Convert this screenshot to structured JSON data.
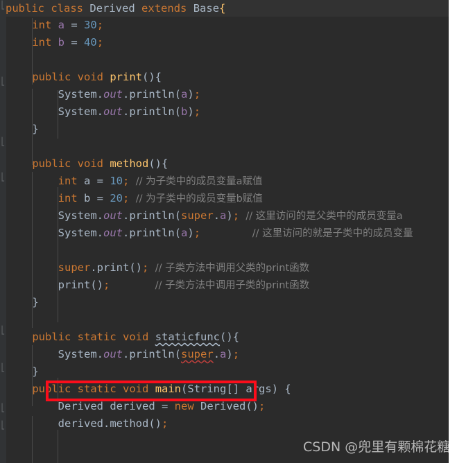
{
  "editor": {
    "theme": "darcula",
    "background": "#2b2b2b",
    "gutter_background": "#313335",
    "current_line_background": "#323232",
    "accent_red": "#fc0d1b",
    "font_size_px": 15.5,
    "line_height_px": 25
  },
  "gutter": {
    "fold_markers": [
      "⎣",
      "⎣",
      "⎣",
      "⎣",
      "⎣",
      "⎣",
      "⎣",
      "⎣"
    ]
  },
  "code_lines": [
    {
      "indent": 0,
      "tokens": [
        {
          "t": "public",
          "c": "kw"
        },
        {
          "t": " ",
          "c": "pln"
        },
        {
          "t": "class",
          "c": "kw"
        },
        {
          "t": " ",
          "c": "pln"
        },
        {
          "t": "Derived",
          "c": "cls"
        },
        {
          "t": " ",
          "c": "pln"
        },
        {
          "t": "extends",
          "c": "kw"
        },
        {
          "t": " ",
          "c": "pln"
        },
        {
          "t": "Base",
          "c": "cls"
        },
        {
          "t": "{",
          "c": "brcy"
        }
      ]
    },
    {
      "indent": 1,
      "tokens": [
        {
          "t": "int",
          "c": "kw"
        },
        {
          "t": " ",
          "c": "pln"
        },
        {
          "t": "a",
          "c": "fld"
        },
        {
          "t": " = ",
          "c": "pln"
        },
        {
          "t": "30",
          "c": "num"
        },
        {
          "t": ";",
          "c": "semi"
        }
      ]
    },
    {
      "indent": 1,
      "tokens": [
        {
          "t": "int",
          "c": "kw"
        },
        {
          "t": " ",
          "c": "pln"
        },
        {
          "t": "b",
          "c": "fld"
        },
        {
          "t": " = ",
          "c": "pln"
        },
        {
          "t": "40",
          "c": "num"
        },
        {
          "t": ";",
          "c": "semi"
        }
      ]
    },
    {
      "indent": 0,
      "tokens": []
    },
    {
      "indent": 1,
      "tokens": [
        {
          "t": "public",
          "c": "kw"
        },
        {
          "t": " ",
          "c": "pln"
        },
        {
          "t": "void",
          "c": "kw"
        },
        {
          "t": " ",
          "c": "pln"
        },
        {
          "t": "print",
          "c": "fn"
        },
        {
          "t": "(){",
          "c": "brc"
        }
      ]
    },
    {
      "indent": 2,
      "tokens": [
        {
          "t": "System",
          "c": "pln"
        },
        {
          "t": ".",
          "c": "pln"
        },
        {
          "t": "out",
          "c": "stat"
        },
        {
          "t": ".",
          "c": "pln"
        },
        {
          "t": "println",
          "c": "pln"
        },
        {
          "t": "(",
          "c": "brc"
        },
        {
          "t": "a",
          "c": "fld"
        },
        {
          "t": ")",
          "c": "brc"
        },
        {
          "t": ";",
          "c": "semi"
        }
      ]
    },
    {
      "indent": 2,
      "tokens": [
        {
          "t": "System",
          "c": "pln"
        },
        {
          "t": ".",
          "c": "pln"
        },
        {
          "t": "out",
          "c": "stat"
        },
        {
          "t": ".",
          "c": "pln"
        },
        {
          "t": "println",
          "c": "pln"
        },
        {
          "t": "(",
          "c": "brc"
        },
        {
          "t": "b",
          "c": "fld"
        },
        {
          "t": ")",
          "c": "brc"
        },
        {
          "t": ";",
          "c": "semi"
        }
      ]
    },
    {
      "indent": 1,
      "tokens": [
        {
          "t": "}",
          "c": "brc"
        }
      ]
    },
    {
      "indent": 0,
      "tokens": []
    },
    {
      "indent": 1,
      "tokens": [
        {
          "t": "public",
          "c": "kw"
        },
        {
          "t": " ",
          "c": "pln"
        },
        {
          "t": "void",
          "c": "kw"
        },
        {
          "t": " ",
          "c": "pln"
        },
        {
          "t": "method",
          "c": "fn"
        },
        {
          "t": "(){",
          "c": "brc"
        }
      ]
    },
    {
      "indent": 2,
      "tokens": [
        {
          "t": "int",
          "c": "kw"
        },
        {
          "t": " ",
          "c": "pln"
        },
        {
          "t": "a",
          "c": "pln"
        },
        {
          "t": " = ",
          "c": "pln"
        },
        {
          "t": "10",
          "c": "num"
        },
        {
          "t": ";",
          "c": "semi"
        },
        {
          "t": " ",
          "c": "pln"
        },
        {
          "t": "// 为子类中的成员变量a赋值",
          "c": "cmt"
        }
      ]
    },
    {
      "indent": 2,
      "tokens": [
        {
          "t": "int",
          "c": "kw"
        },
        {
          "t": " ",
          "c": "pln"
        },
        {
          "t": "b",
          "c": "pln"
        },
        {
          "t": " = ",
          "c": "pln"
        },
        {
          "t": "20",
          "c": "num"
        },
        {
          "t": ";",
          "c": "semi"
        },
        {
          "t": " ",
          "c": "pln"
        },
        {
          "t": "// 为子类中的成员变量b赋值",
          "c": "cmt"
        }
      ]
    },
    {
      "indent": 2,
      "tokens": [
        {
          "t": "System",
          "c": "pln"
        },
        {
          "t": ".",
          "c": "pln"
        },
        {
          "t": "out",
          "c": "stat"
        },
        {
          "t": ".",
          "c": "pln"
        },
        {
          "t": "println",
          "c": "pln"
        },
        {
          "t": "(",
          "c": "brc"
        },
        {
          "t": "super",
          "c": "kw"
        },
        {
          "t": ".",
          "c": "pln"
        },
        {
          "t": "a",
          "c": "fld"
        },
        {
          "t": ")",
          "c": "brc"
        },
        {
          "t": ";",
          "c": "semi"
        },
        {
          "t": " ",
          "c": "pln"
        },
        {
          "t": "// 这里访问的是父类中的成员变量a",
          "c": "cmt"
        }
      ]
    },
    {
      "indent": 2,
      "tokens": [
        {
          "t": "System",
          "c": "pln"
        },
        {
          "t": ".",
          "c": "pln"
        },
        {
          "t": "out",
          "c": "stat"
        },
        {
          "t": ".",
          "c": "pln"
        },
        {
          "t": "println",
          "c": "pln"
        },
        {
          "t": "(",
          "c": "brc"
        },
        {
          "t": "a",
          "c": "fld"
        },
        {
          "t": ")",
          "c": "brc"
        },
        {
          "t": ";",
          "c": "semi"
        },
        {
          "t": "        ",
          "c": "pln"
        },
        {
          "t": "// 这里访问的就是子类中的成员变量",
          "c": "cmt"
        }
      ]
    },
    {
      "indent": 0,
      "tokens": []
    },
    {
      "indent": 2,
      "tokens": [
        {
          "t": "super",
          "c": "kw"
        },
        {
          "t": ".",
          "c": "pln"
        },
        {
          "t": "print",
          "c": "pln"
        },
        {
          "t": "()",
          "c": "brc"
        },
        {
          "t": ";",
          "c": "semi"
        },
        {
          "t": " ",
          "c": "pln"
        },
        {
          "t": "// 子类方法中调用父类的print函数",
          "c": "cmt"
        }
      ]
    },
    {
      "indent": 2,
      "tokens": [
        {
          "t": "print",
          "c": "pln"
        },
        {
          "t": "()",
          "c": "brc"
        },
        {
          "t": ";",
          "c": "semi"
        },
        {
          "t": "       ",
          "c": "pln"
        },
        {
          "t": "// 子类方法中调用子类的print函数",
          "c": "cmt"
        }
      ]
    },
    {
      "indent": 1,
      "tokens": [
        {
          "t": "}",
          "c": "brc"
        }
      ]
    },
    {
      "indent": 0,
      "tokens": []
    },
    {
      "indent": 1,
      "tokens": [
        {
          "t": "public",
          "c": "kw"
        },
        {
          "t": " ",
          "c": "pln"
        },
        {
          "t": "static",
          "c": "kw"
        },
        {
          "t": " ",
          "c": "pln"
        },
        {
          "t": "void",
          "c": "kw"
        },
        {
          "t": " ",
          "c": "pln"
        },
        {
          "t": "staticfunc",
          "c": "err"
        },
        {
          "t": "(){",
          "c": "brc"
        }
      ]
    },
    {
      "indent": 2,
      "tokens": [
        {
          "t": "System",
          "c": "pln"
        },
        {
          "t": ".",
          "c": "pln"
        },
        {
          "t": "out",
          "c": "stat"
        },
        {
          "t": ".",
          "c": "pln"
        },
        {
          "t": "println",
          "c": "pln"
        },
        {
          "t": "(",
          "c": "brc"
        },
        {
          "t": "super",
          "c": "errw"
        },
        {
          "t": ".",
          "c": "pln"
        },
        {
          "t": "a",
          "c": "fld"
        },
        {
          "t": ")",
          "c": "brc"
        },
        {
          "t": ";",
          "c": "semi"
        }
      ]
    },
    {
      "indent": 1,
      "tokens": [
        {
          "t": "}",
          "c": "brc"
        }
      ]
    },
    {
      "indent": 1,
      "tokens": [
        {
          "t": "public",
          "c": "kw"
        },
        {
          "t": " ",
          "c": "pln"
        },
        {
          "t": "static",
          "c": "kw"
        },
        {
          "t": " ",
          "c": "pln"
        },
        {
          "t": "void",
          "c": "kw"
        },
        {
          "t": " ",
          "c": "pln"
        },
        {
          "t": "main",
          "c": "fn"
        },
        {
          "t": "(",
          "c": "brc"
        },
        {
          "t": "String",
          "c": "cls"
        },
        {
          "t": "[] ",
          "c": "brc"
        },
        {
          "t": "args",
          "c": "pln"
        },
        {
          "t": ") {",
          "c": "brc"
        }
      ]
    },
    {
      "indent": 2,
      "tokens": [
        {
          "t": "Derived",
          "c": "cls"
        },
        {
          "t": " ",
          "c": "pln"
        },
        {
          "t": "derived",
          "c": "pln"
        },
        {
          "t": " = ",
          "c": "pln"
        },
        {
          "t": "new",
          "c": "kw"
        },
        {
          "t": " ",
          "c": "pln"
        },
        {
          "t": "Derived",
          "c": "cls"
        },
        {
          "t": "()",
          "c": "brc"
        },
        {
          "t": ";",
          "c": "semi"
        }
      ]
    },
    {
      "indent": 2,
      "tokens": [
        {
          "t": "derived",
          "c": "pln"
        },
        {
          "t": ".",
          "c": "pln"
        },
        {
          "t": "method",
          "c": "pln"
        },
        {
          "t": "()",
          "c": "brc"
        },
        {
          "t": ";",
          "c": "semi"
        }
      ]
    }
  ],
  "annotation": {
    "red_box_label": "highlighted-error-line",
    "red_box_color": "#fc0d1b"
  },
  "watermark": {
    "text": "CSDN @兜里有颗棉花糖",
    "color": "#b8b8b8"
  }
}
